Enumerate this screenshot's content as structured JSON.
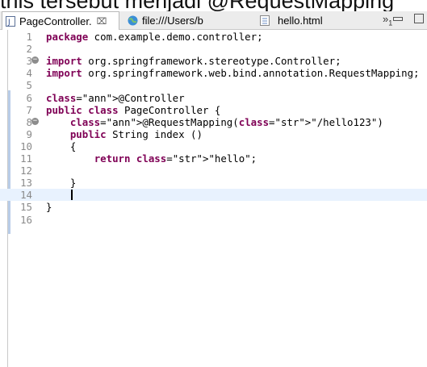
{
  "caption": "this tersebut menjadi @RequestMapping",
  "tabs": [
    {
      "label": "PageController.",
      "close": "⌧"
    },
    {
      "label": "file:///Users/b"
    },
    {
      "label": "hello.html"
    }
  ],
  "overflow": {
    "chevrons": "»",
    "count": "1"
  },
  "editor": {
    "lines": [
      {
        "n": "1",
        "text": "package com.example.demo.controller;"
      },
      {
        "n": "2",
        "text": ""
      },
      {
        "n": "3",
        "text": "import org.springframework.stereotype.Controller;"
      },
      {
        "n": "4",
        "text": "import org.springframework.web.bind.annotation.RequestMapping;"
      },
      {
        "n": "5",
        "text": ""
      },
      {
        "n": "6",
        "text": "@Controller"
      },
      {
        "n": "7",
        "text": "public class PageController {"
      },
      {
        "n": "8",
        "text": "    @RequestMapping(\"/hello123\")"
      },
      {
        "n": "9",
        "text": "    public String index ()"
      },
      {
        "n": "10",
        "text": "    {"
      },
      {
        "n": "11",
        "text": "        return \"hello\";"
      },
      {
        "n": "12",
        "text": ""
      },
      {
        "n": "13",
        "text": "    }"
      },
      {
        "n": "14",
        "text": ""
      },
      {
        "n": "15",
        "text": "}"
      },
      {
        "n": "16",
        "text": ""
      }
    ]
  },
  "icons": {
    "java_file": "java-file-icon",
    "browser": "globe-icon",
    "html_file": "html-file-icon"
  }
}
